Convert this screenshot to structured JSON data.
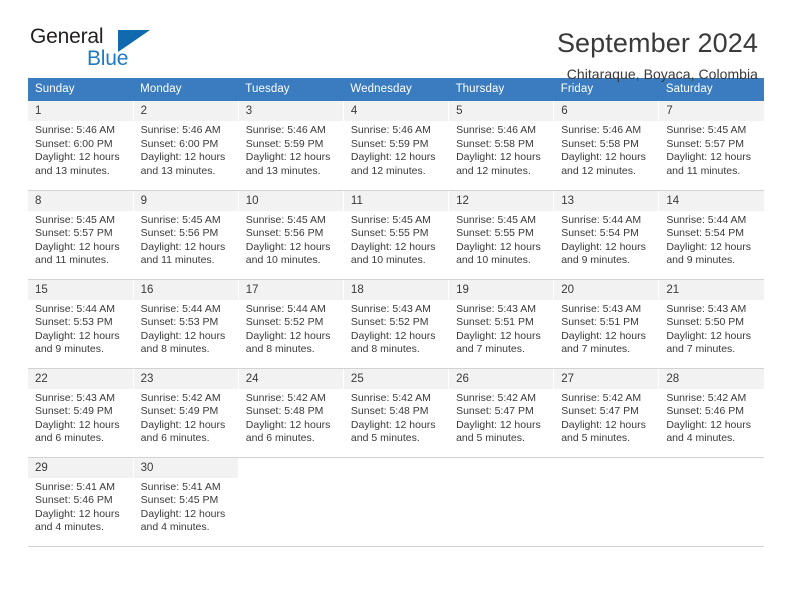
{
  "logo": {
    "word1": "General",
    "word2": "Blue",
    "triangle_color": "#1169ae",
    "blue_color": "#1f7ac4"
  },
  "header": {
    "title": "September 2024",
    "subtitle": "Chitaraque, Boyaca, Colombia"
  },
  "theme": {
    "header_row_bg": "#3a7cbf",
    "daynum_bg": "#f2f2f2",
    "grid_line": "#d3d3d3",
    "text": "#3a3a3a"
  },
  "weekday_headers": [
    "Sunday",
    "Monday",
    "Tuesday",
    "Wednesday",
    "Thursday",
    "Friday",
    "Saturday"
  ],
  "labels": {
    "sunrise": "Sunrise:",
    "sunset": "Sunset:",
    "daylight": "Daylight:"
  },
  "weeks": [
    [
      {
        "day": "1",
        "sunrise": "Sunrise: 5:46 AM",
        "sunset": "Sunset: 6:00 PM",
        "daylight1": "Daylight: 12 hours",
        "daylight2": "and 13 minutes."
      },
      {
        "day": "2",
        "sunrise": "Sunrise: 5:46 AM",
        "sunset": "Sunset: 6:00 PM",
        "daylight1": "Daylight: 12 hours",
        "daylight2": "and 13 minutes."
      },
      {
        "day": "3",
        "sunrise": "Sunrise: 5:46 AM",
        "sunset": "Sunset: 5:59 PM",
        "daylight1": "Daylight: 12 hours",
        "daylight2": "and 13 minutes."
      },
      {
        "day": "4",
        "sunrise": "Sunrise: 5:46 AM",
        "sunset": "Sunset: 5:59 PM",
        "daylight1": "Daylight: 12 hours",
        "daylight2": "and 12 minutes."
      },
      {
        "day": "5",
        "sunrise": "Sunrise: 5:46 AM",
        "sunset": "Sunset: 5:58 PM",
        "daylight1": "Daylight: 12 hours",
        "daylight2": "and 12 minutes."
      },
      {
        "day": "6",
        "sunrise": "Sunrise: 5:46 AM",
        "sunset": "Sunset: 5:58 PM",
        "daylight1": "Daylight: 12 hours",
        "daylight2": "and 12 minutes."
      },
      {
        "day": "7",
        "sunrise": "Sunrise: 5:45 AM",
        "sunset": "Sunset: 5:57 PM",
        "daylight1": "Daylight: 12 hours",
        "daylight2": "and 11 minutes."
      }
    ],
    [
      {
        "day": "8",
        "sunrise": "Sunrise: 5:45 AM",
        "sunset": "Sunset: 5:57 PM",
        "daylight1": "Daylight: 12 hours",
        "daylight2": "and 11 minutes."
      },
      {
        "day": "9",
        "sunrise": "Sunrise: 5:45 AM",
        "sunset": "Sunset: 5:56 PM",
        "daylight1": "Daylight: 12 hours",
        "daylight2": "and 11 minutes."
      },
      {
        "day": "10",
        "sunrise": "Sunrise: 5:45 AM",
        "sunset": "Sunset: 5:56 PM",
        "daylight1": "Daylight: 12 hours",
        "daylight2": "and 10 minutes."
      },
      {
        "day": "11",
        "sunrise": "Sunrise: 5:45 AM",
        "sunset": "Sunset: 5:55 PM",
        "daylight1": "Daylight: 12 hours",
        "daylight2": "and 10 minutes."
      },
      {
        "day": "12",
        "sunrise": "Sunrise: 5:45 AM",
        "sunset": "Sunset: 5:55 PM",
        "daylight1": "Daylight: 12 hours",
        "daylight2": "and 10 minutes."
      },
      {
        "day": "13",
        "sunrise": "Sunrise: 5:44 AM",
        "sunset": "Sunset: 5:54 PM",
        "daylight1": "Daylight: 12 hours",
        "daylight2": "and 9 minutes."
      },
      {
        "day": "14",
        "sunrise": "Sunrise: 5:44 AM",
        "sunset": "Sunset: 5:54 PM",
        "daylight1": "Daylight: 12 hours",
        "daylight2": "and 9 minutes."
      }
    ],
    [
      {
        "day": "15",
        "sunrise": "Sunrise: 5:44 AM",
        "sunset": "Sunset: 5:53 PM",
        "daylight1": "Daylight: 12 hours",
        "daylight2": "and 9 minutes."
      },
      {
        "day": "16",
        "sunrise": "Sunrise: 5:44 AM",
        "sunset": "Sunset: 5:53 PM",
        "daylight1": "Daylight: 12 hours",
        "daylight2": "and 8 minutes."
      },
      {
        "day": "17",
        "sunrise": "Sunrise: 5:44 AM",
        "sunset": "Sunset: 5:52 PM",
        "daylight1": "Daylight: 12 hours",
        "daylight2": "and 8 minutes."
      },
      {
        "day": "18",
        "sunrise": "Sunrise: 5:43 AM",
        "sunset": "Sunset: 5:52 PM",
        "daylight1": "Daylight: 12 hours",
        "daylight2": "and 8 minutes."
      },
      {
        "day": "19",
        "sunrise": "Sunrise: 5:43 AM",
        "sunset": "Sunset: 5:51 PM",
        "daylight1": "Daylight: 12 hours",
        "daylight2": "and 7 minutes."
      },
      {
        "day": "20",
        "sunrise": "Sunrise: 5:43 AM",
        "sunset": "Sunset: 5:51 PM",
        "daylight1": "Daylight: 12 hours",
        "daylight2": "and 7 minutes."
      },
      {
        "day": "21",
        "sunrise": "Sunrise: 5:43 AM",
        "sunset": "Sunset: 5:50 PM",
        "daylight1": "Daylight: 12 hours",
        "daylight2": "and 7 minutes."
      }
    ],
    [
      {
        "day": "22",
        "sunrise": "Sunrise: 5:43 AM",
        "sunset": "Sunset: 5:49 PM",
        "daylight1": "Daylight: 12 hours",
        "daylight2": "and 6 minutes."
      },
      {
        "day": "23",
        "sunrise": "Sunrise: 5:42 AM",
        "sunset": "Sunset: 5:49 PM",
        "daylight1": "Daylight: 12 hours",
        "daylight2": "and 6 minutes."
      },
      {
        "day": "24",
        "sunrise": "Sunrise: 5:42 AM",
        "sunset": "Sunset: 5:48 PM",
        "daylight1": "Daylight: 12 hours",
        "daylight2": "and 6 minutes."
      },
      {
        "day": "25",
        "sunrise": "Sunrise: 5:42 AM",
        "sunset": "Sunset: 5:48 PM",
        "daylight1": "Daylight: 12 hours",
        "daylight2": "and 5 minutes."
      },
      {
        "day": "26",
        "sunrise": "Sunrise: 5:42 AM",
        "sunset": "Sunset: 5:47 PM",
        "daylight1": "Daylight: 12 hours",
        "daylight2": "and 5 minutes."
      },
      {
        "day": "27",
        "sunrise": "Sunrise: 5:42 AM",
        "sunset": "Sunset: 5:47 PM",
        "daylight1": "Daylight: 12 hours",
        "daylight2": "and 5 minutes."
      },
      {
        "day": "28",
        "sunrise": "Sunrise: 5:42 AM",
        "sunset": "Sunset: 5:46 PM",
        "daylight1": "Daylight: 12 hours",
        "daylight2": "and 4 minutes."
      }
    ],
    [
      {
        "day": "29",
        "sunrise": "Sunrise: 5:41 AM",
        "sunset": "Sunset: 5:46 PM",
        "daylight1": "Daylight: 12 hours",
        "daylight2": "and 4 minutes."
      },
      {
        "day": "30",
        "sunrise": "Sunrise: 5:41 AM",
        "sunset": "Sunset: 5:45 PM",
        "daylight1": "Daylight: 12 hours",
        "daylight2": "and 4 minutes."
      },
      {
        "day": "",
        "sunrise": "",
        "sunset": "",
        "daylight1": "",
        "daylight2": ""
      },
      {
        "day": "",
        "sunrise": "",
        "sunset": "",
        "daylight1": "",
        "daylight2": ""
      },
      {
        "day": "",
        "sunrise": "",
        "sunset": "",
        "daylight1": "",
        "daylight2": ""
      },
      {
        "day": "",
        "sunrise": "",
        "sunset": "",
        "daylight1": "",
        "daylight2": ""
      },
      {
        "day": "",
        "sunrise": "",
        "sunset": "",
        "daylight1": "",
        "daylight2": ""
      }
    ]
  ]
}
